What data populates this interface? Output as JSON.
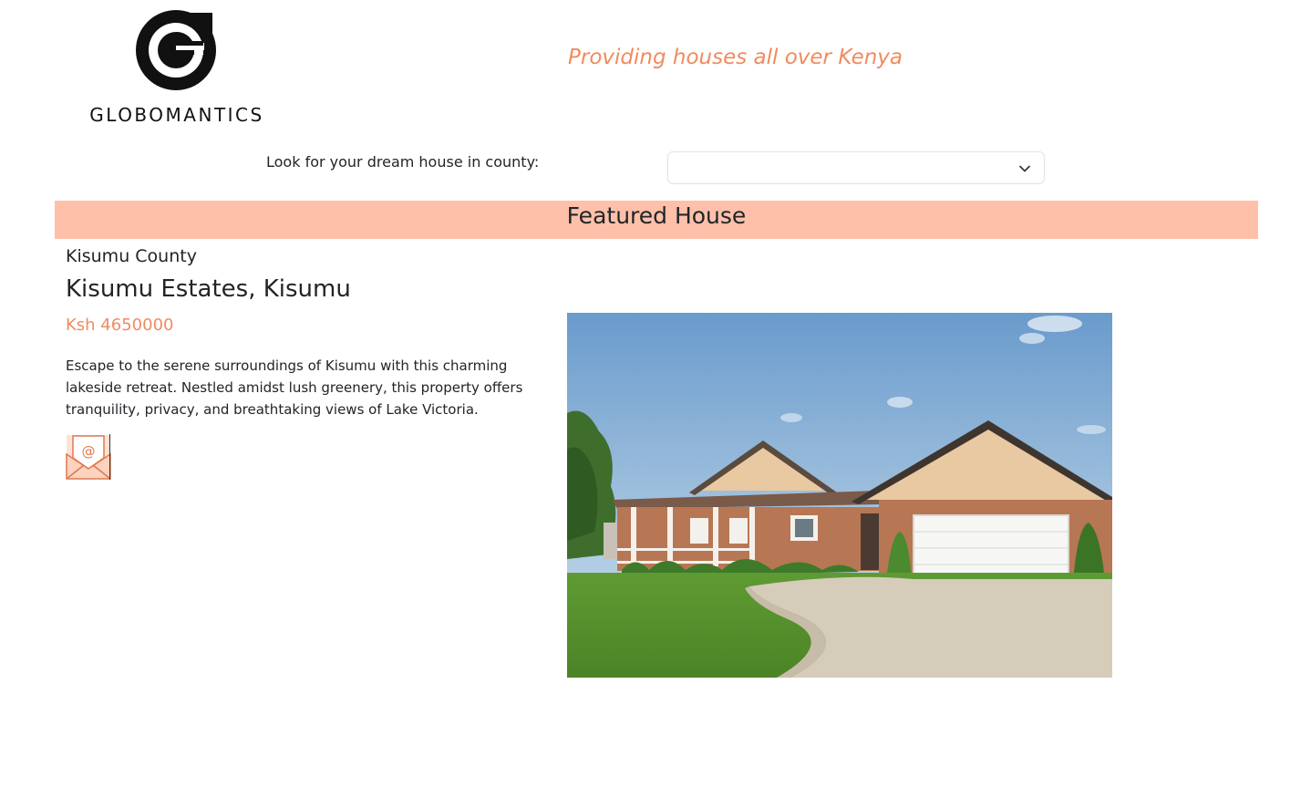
{
  "brand": {
    "name": "GLOBOMANTICS",
    "tagline": "Providing houses all over Kenya"
  },
  "search": {
    "label": "Look for your dream house in county:",
    "selected": ""
  },
  "featured": {
    "heading": "Featured House",
    "county": "Kisumu County",
    "address": "Kisumu Estates, Kisumu",
    "price": "Ksh 4650000",
    "description": "Escape to the serene surroundings of Kisumu with this charming lakeside retreat. Nestled amidst lush greenery, this property offers tranquility, privacy, and breathtaking views of Lake Victoria."
  },
  "icons": {
    "logo": "globomantics-g-logo",
    "select_arrow": "chevron-down-icon",
    "contact": "email-envelope-icon",
    "photo": "house-photo"
  },
  "colors": {
    "accent": "#f08b5f",
    "banner": "#ffc0a9",
    "text": "#212529"
  }
}
